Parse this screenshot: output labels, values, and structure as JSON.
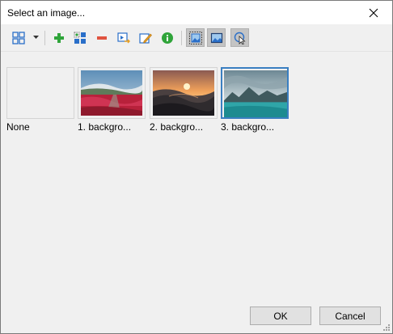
{
  "dialog": {
    "title": "Select an image..."
  },
  "toolbar": {
    "buttons": [
      {
        "name": "view-mode",
        "icon": "grid-view-icon"
      },
      {
        "name": "view-dropdown",
        "icon": "chevron-down-icon"
      },
      {
        "name": "add",
        "icon": "plus-icon"
      },
      {
        "name": "add-from-gallery",
        "icon": "add-multiple-icon"
      },
      {
        "name": "remove",
        "icon": "minus-icon"
      },
      {
        "name": "export",
        "icon": "export-image-icon"
      },
      {
        "name": "edit",
        "icon": "edit-image-icon"
      },
      {
        "name": "info",
        "icon": "info-icon"
      },
      {
        "name": "fit-image",
        "icon": "image-select-icon"
      },
      {
        "name": "image-view",
        "icon": "image-icon"
      },
      {
        "name": "pointer",
        "icon": "cursor-icon"
      }
    ]
  },
  "images": [
    {
      "label": "None",
      "kind": "empty"
    },
    {
      "label": "1. backgro...",
      "kind": "flowers"
    },
    {
      "label": "2. backgro...",
      "kind": "sunset"
    },
    {
      "label": "3. backgro...",
      "kind": "lake"
    }
  ],
  "selected_index": 3,
  "footer": {
    "ok_label": "OK",
    "cancel_label": "Cancel"
  },
  "colors": {
    "accent": "#3a7fc1",
    "green": "#2fa43a",
    "red": "#e0533f",
    "blue": "#2a6fc9"
  }
}
